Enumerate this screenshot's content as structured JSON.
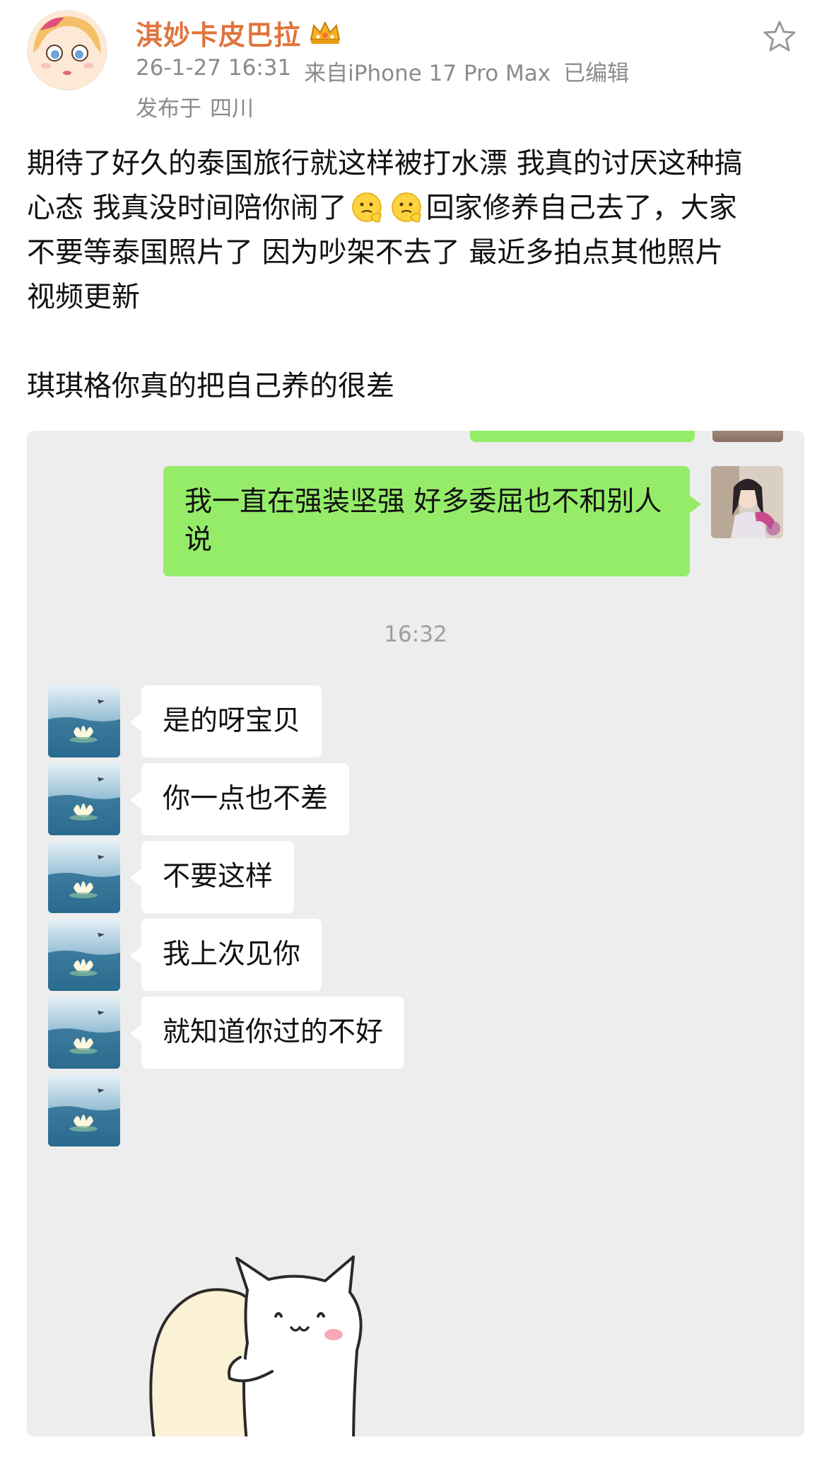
{
  "post": {
    "username": "淇妙卡皮巴拉",
    "badge_icon": "crown-badge-icon",
    "timestamp": "26-1-27 16:31",
    "source": "来自iPhone 17 Pro Max",
    "edited": "已编辑",
    "location_label": "发布于",
    "location": "四川",
    "star_icon": "star-outline-icon",
    "text_lines": [
      "期待了好久的泰国旅行就这样被打水漂 我真的讨厌这种搞",
      "心态  我真没时间陪你闹了",
      "回家修养自己去了，大家",
      "不要等泰国照片了 因为吵架不去了 最近多拍点其他照片",
      "视频更新"
    ],
    "emoji_icon": "salute-face-emoji",
    "text_para2": "琪琪格你真的把自己养的很差",
    "username_color": "#e0743b"
  },
  "chat": {
    "background": "#ededed",
    "sent_bubble_color": "#95ec69",
    "sent_message": "我一直在强装坚强 好多委屈也不和别人说",
    "time_divider": "16:32",
    "received_messages": [
      "是的呀宝贝",
      "你一点也不差",
      "不要这样",
      "我上次见你",
      "就知道你过的不好"
    ],
    "sticker": "hug-sticker"
  }
}
